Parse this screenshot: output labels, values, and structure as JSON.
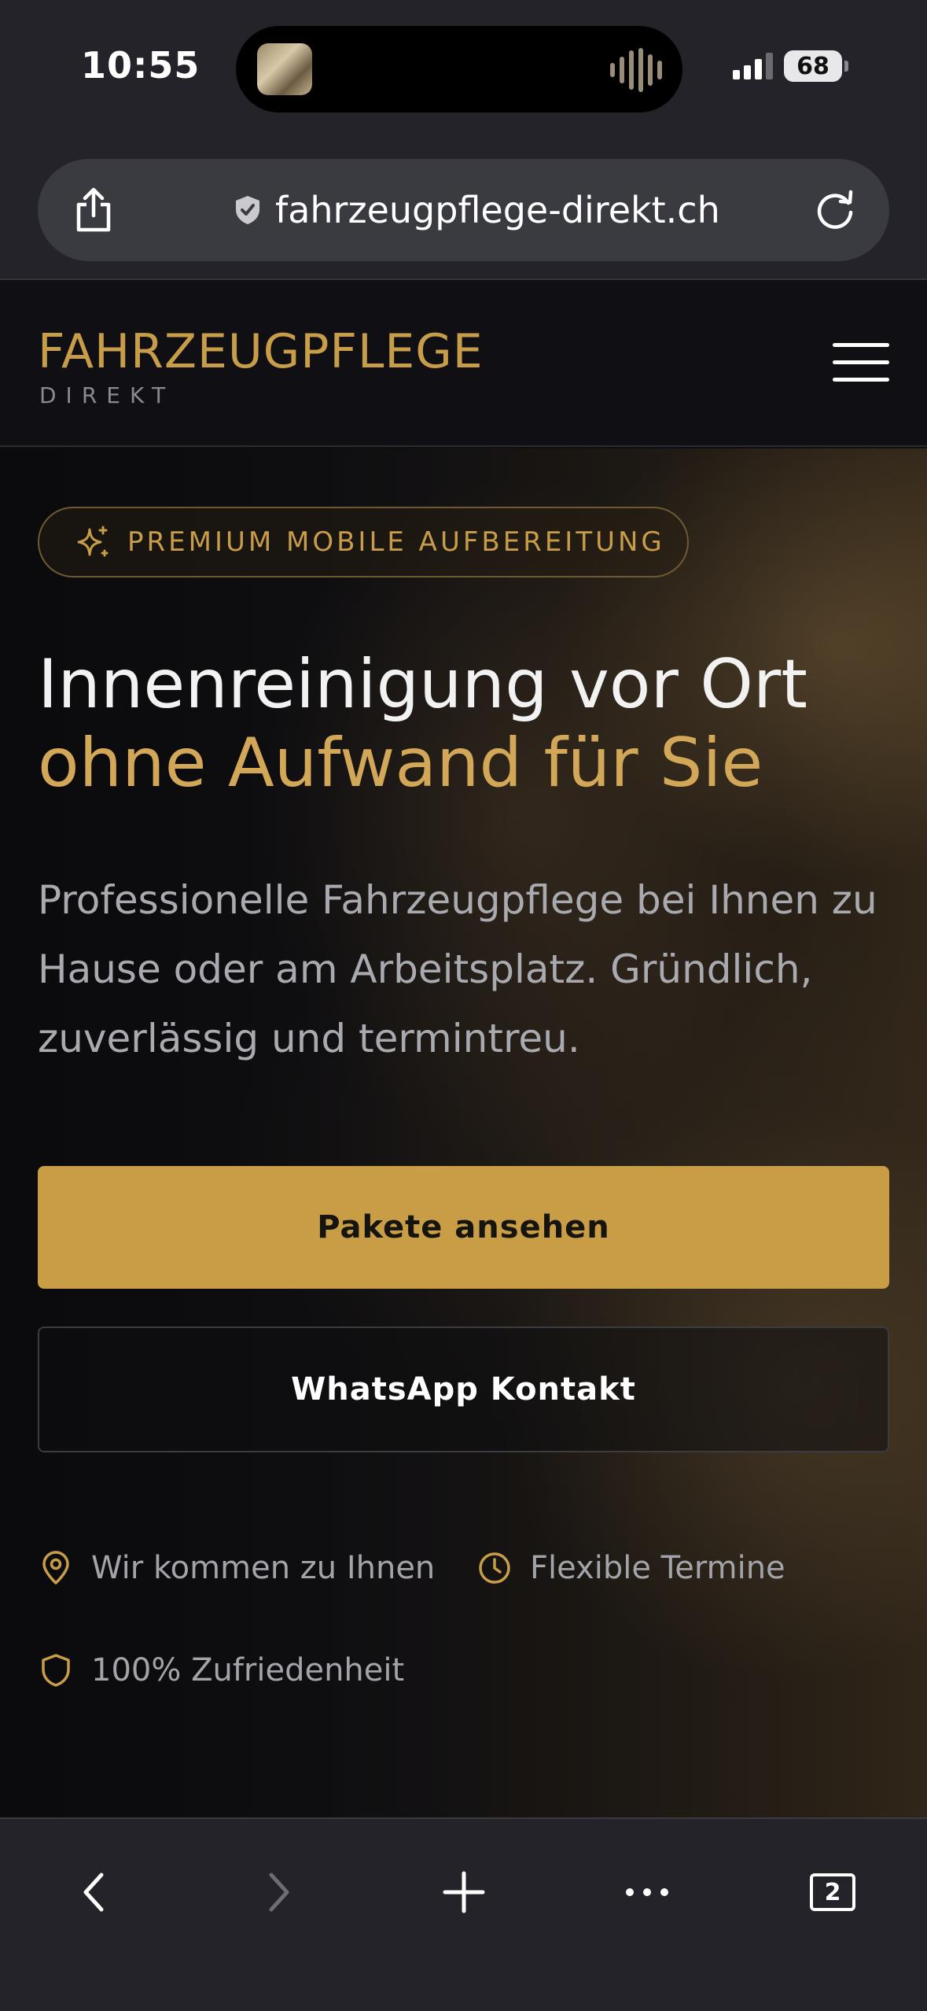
{
  "status_bar": {
    "time": "10:55",
    "battery": "68"
  },
  "browser": {
    "url": "fahrzeugpflege-direkt.ch",
    "share_icon": "share-icon",
    "secure_icon": "shield-check-icon",
    "reload_icon": "reload-icon",
    "toolbar": {
      "back_icon": "chevron-left-icon",
      "forward_icon": "chevron-right-icon",
      "new_tab_icon": "plus-icon",
      "more_icon": "ellipsis-icon",
      "tabs_count": "2"
    }
  },
  "site": {
    "logo_main": "FAHRZEUGPFLEGE",
    "logo_sub": "DIREKT",
    "menu_icon": "hamburger-menu-icon"
  },
  "hero": {
    "badge": "PREMIUM MOBILE AUFBEREITUNG",
    "headline_line1": "Innenreinigung vor Ort",
    "headline_line2": "ohne Aufwand für Sie",
    "lead": "Professionelle Fahrzeugpflege bei Ihnen zu Hause oder am Arbeitsplatz. Gründlich, zuverlässig und termintreu.",
    "cta_primary": "Pakete ansehen",
    "cta_secondary": "WhatsApp Kontakt",
    "features": [
      {
        "icon": "map-pin-icon",
        "label": "Wir kommen zu Ihnen"
      },
      {
        "icon": "clock-icon",
        "label": "Flexible Termine"
      },
      {
        "icon": "shield-icon",
        "label": "100% Zufriedenheit"
      }
    ]
  },
  "colors": {
    "accent_gold": "#c89d45",
    "background": "#0f0f12",
    "browser_chrome": "#232329"
  }
}
